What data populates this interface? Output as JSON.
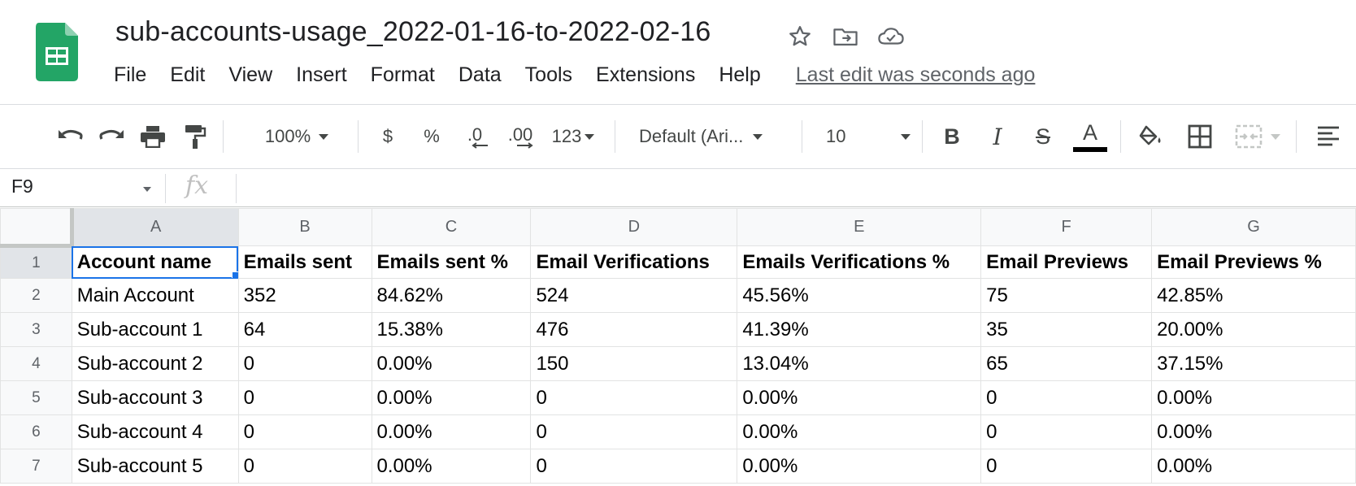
{
  "document": {
    "title": "sub-accounts-usage_2022-01-16-to-2022-02-16",
    "title_icons": [
      "star-icon",
      "move-to-folder-icon",
      "cloud-status-icon"
    ]
  },
  "menu": {
    "items": [
      "File",
      "Edit",
      "View",
      "Insert",
      "Format",
      "Data",
      "Tools",
      "Extensions",
      "Help"
    ],
    "last_edit": "Last edit was seconds ago"
  },
  "toolbar": {
    "zoom": "100%",
    "currency": "$",
    "percent": "%",
    "decrease_decimal": ".0",
    "increase_decimal": ".00",
    "more_formats": "123",
    "font": "Default (Ari...",
    "font_size": "10",
    "bold": "B",
    "italic": "I",
    "strikethrough": "S",
    "text_color_letter": "A",
    "icons": [
      "undo-icon",
      "redo-icon",
      "print-icon",
      "paint-format-icon",
      "fill-color-icon",
      "borders-icon",
      "merge-cells-icon",
      "align-left-icon"
    ]
  },
  "formula_bar": {
    "name_box": "F9",
    "fx": "fx",
    "value": ""
  },
  "sheet": {
    "columns": [
      "A",
      "B",
      "C",
      "D",
      "E",
      "F",
      "G"
    ],
    "rows": [
      {
        "num": "1",
        "cells": [
          "Account name",
          "Emails sent",
          "Emails sent %",
          "Email Verifications",
          "Emails Verifications %",
          "Email Previews",
          "Email Previews %"
        ]
      },
      {
        "num": "2",
        "cells": [
          "Main Account",
          "352",
          "84.62%",
          "524",
          "45.56%",
          "75",
          "42.85%"
        ]
      },
      {
        "num": "3",
        "cells": [
          "Sub-account 1",
          "64",
          "15.38%",
          "476",
          "41.39%",
          "35",
          "20.00%"
        ]
      },
      {
        "num": "4",
        "cells": [
          "Sub-account 2",
          "0",
          "0.00%",
          "150",
          "13.04%",
          "65",
          "37.15%"
        ]
      },
      {
        "num": "5",
        "cells": [
          "Sub-account 3",
          "0",
          "0.00%",
          "0",
          "0.00%",
          "0",
          "0.00%"
        ]
      },
      {
        "num": "6",
        "cells": [
          "Sub-account 4",
          "0",
          "0.00%",
          "0",
          "0.00%",
          "0",
          "0.00%"
        ]
      },
      {
        "num": "7",
        "cells": [
          "Sub-account 5",
          "0",
          "0.00%",
          "0",
          "0.00%",
          "0",
          "0.00%"
        ]
      }
    ]
  },
  "colors": {
    "accent": "#1a73e8",
    "sheets_green": "#23a566",
    "grid_line": "#e2e3e3",
    "header_bg": "#f8f9fa",
    "selected_header_bg": "#e1e4e8"
  }
}
